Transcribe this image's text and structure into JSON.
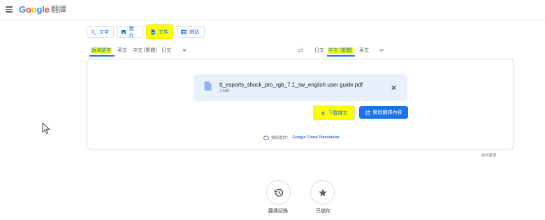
{
  "header": {
    "logo_letters": [
      {
        "char": "G",
        "color": "#4285f4"
      },
      {
        "char": "o",
        "color": "#ea4335"
      },
      {
        "char": "o",
        "color": "#fbbc05"
      },
      {
        "char": "g",
        "color": "#4285f4"
      },
      {
        "char": "l",
        "color": "#34a853"
      },
      {
        "char": "e",
        "color": "#ea4335"
      }
    ],
    "product_name": "翻譯"
  },
  "mode_tabs": [
    {
      "label": "文字",
      "icon": "translate-icon",
      "active": false
    },
    {
      "label": "圖片",
      "icon": "image-icon",
      "active": false
    },
    {
      "label": "文件",
      "icon": "document-icon",
      "active": true
    },
    {
      "label": "網站",
      "icon": "website-icon",
      "active": false
    }
  ],
  "source_languages": [
    "偵測語言",
    "英文",
    "中文 (繁體)",
    "日文"
  ],
  "target_languages": [
    "日文",
    "中文 (繁體)",
    "英文"
  ],
  "file": {
    "name": "tt_esports_shock_pro_rgb_7.1_sw_english user guide.pdf",
    "size": "2 MB"
  },
  "actions": {
    "download_label": "下載譯文",
    "open_label": "開啟翻譯內容"
  },
  "powered_by": {
    "prefix": "技術提供：",
    "link": "Google Cloud Translation"
  },
  "feedback_label": "提供意見",
  "bottom_buttons": [
    {
      "label": "翻譯記錄",
      "icon": "history-icon"
    },
    {
      "label": "已儲存",
      "icon": "star-icon"
    }
  ],
  "colors": {
    "accent": "#1a73e8",
    "highlight": "#fdfd00",
    "file_card": "#e8f0fe"
  }
}
